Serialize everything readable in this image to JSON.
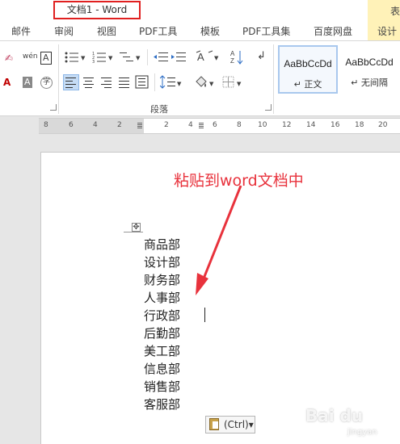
{
  "titlebar": {
    "title": "文档1 - Word",
    "context_tab": "表"
  },
  "tabs": [
    "邮件",
    "审阅",
    "视图",
    "PDF工具",
    "模板",
    "PDF工具集",
    "百度网盘",
    "设计"
  ],
  "ribbon": {
    "group_label": "段落",
    "styles": [
      {
        "sample": "AaBbCcDd",
        "name": "↵ 正文"
      },
      {
        "sample": "AaBbCcDd",
        "name": "↵ 无间隔"
      }
    ],
    "icons": {
      "clear_format": "✍",
      "phonetic": "wén",
      "char_border": "A",
      "shading_a": "A",
      "enclose": "字",
      "font_color": "A"
    }
  },
  "ruler": {
    "numbers": [
      "8",
      "6",
      "4",
      "2",
      "2",
      "4",
      "6",
      "8",
      "10",
      "12",
      "14",
      "16",
      "18",
      "20"
    ]
  },
  "document": {
    "annotation": "粘贴到word文档中",
    "departments": [
      "商品部",
      "设计部",
      "财务部",
      "人事部",
      "行政部",
      "后勤部",
      "美工部",
      "信息部",
      "销售部",
      "客服部"
    ],
    "paste_options": "(Ctrl)▾"
  },
  "watermark": {
    "main": "Bai du",
    "sub": "jingyan"
  },
  "colors": {
    "annotation": "#e8323c",
    "title_highlight": "#e02020",
    "design_tab": "#fff2b8"
  }
}
